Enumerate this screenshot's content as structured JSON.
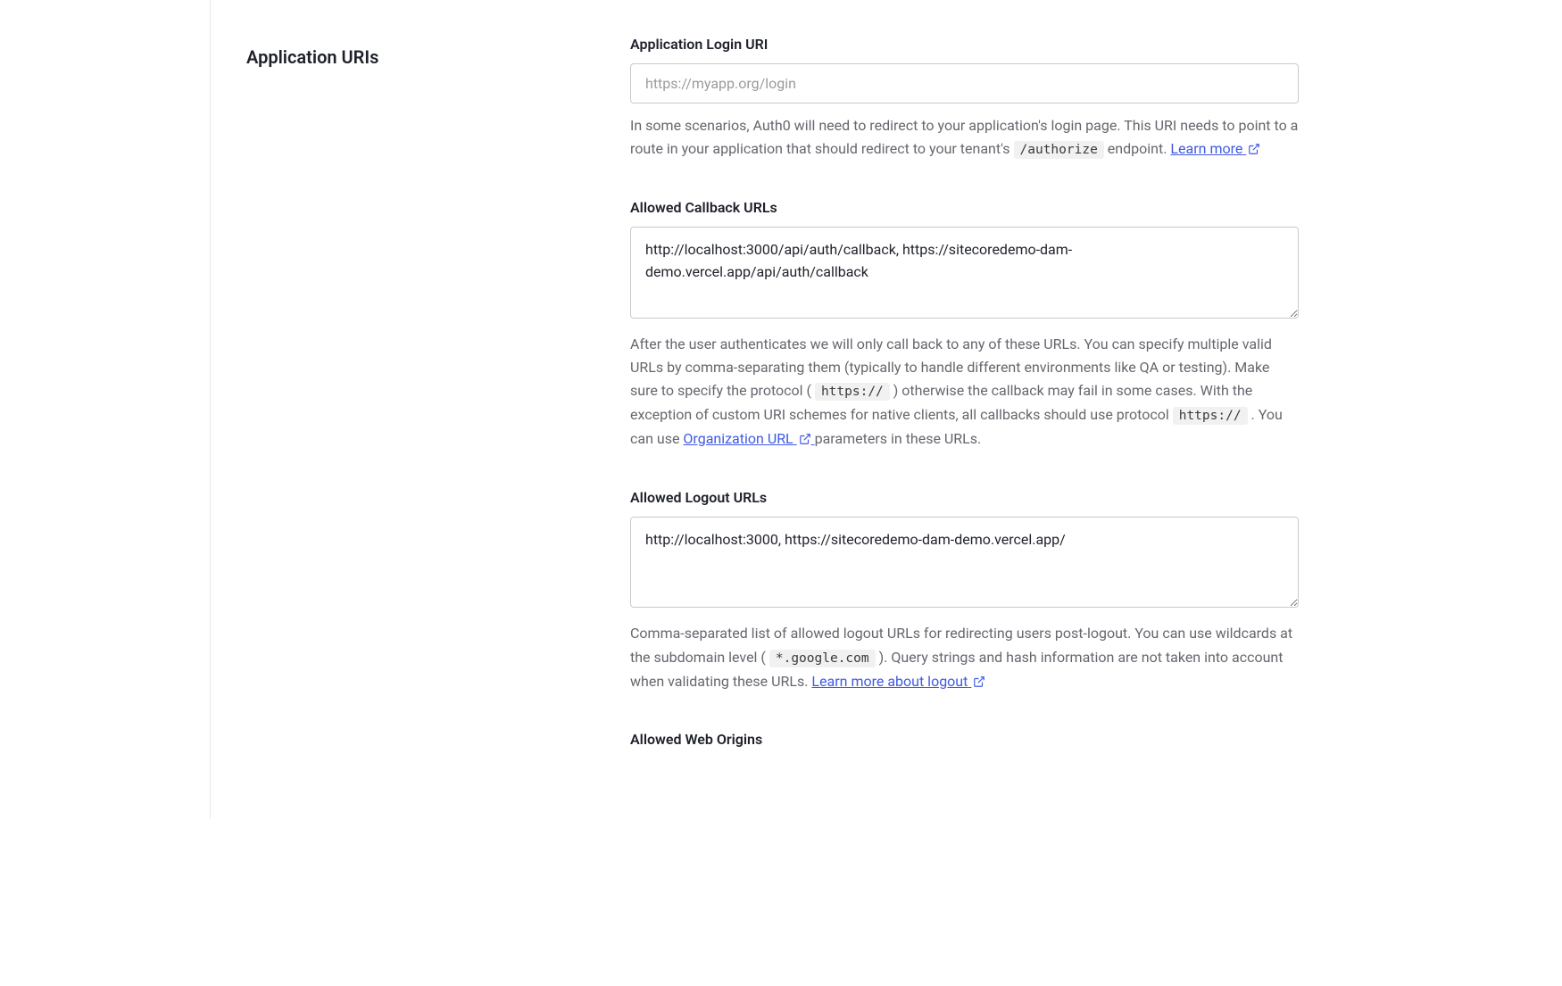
{
  "section": {
    "title": "Application URIs"
  },
  "fields": {
    "login_uri": {
      "label": "Application Login URI",
      "placeholder": "https://myapp.org/login",
      "value": "",
      "help_pre": "In some scenarios, Auth0 will need to redirect to your application's login page. This URI needs to point to a route in your application that should redirect to your tenant's ",
      "help_code": "/authorize",
      "help_post": " endpoint. ",
      "link_text": "Learn more"
    },
    "callback_urls": {
      "label": "Allowed Callback URLs",
      "value": "http://localhost:3000/api/auth/callback, https://sitecoredemo-dam-demo.vercel.app/api/auth/callback",
      "help_p1": "After the user authenticates we will only call back to any of these URLs. You can specify multiple valid URLs by comma-separating them (typically to handle different environments like QA or testing). Make sure to specify the protocol (",
      "help_code1": "https://",
      "help_p2": ") otherwise the callback may fail in some cases. With the exception of custom URI schemes for native clients, all callbacks should use protocol ",
      "help_code2": "https://",
      "help_p3": ". You can use ",
      "link_text": "Organization URL",
      "help_p4": " parameters in these URLs."
    },
    "logout_urls": {
      "label": "Allowed Logout URLs",
      "value": "http://localhost:3000, https://sitecoredemo-dam-demo.vercel.app/",
      "help_p1": "Comma-separated list of allowed logout URLs for redirecting users post-logout. You can use wildcards at the subdomain level (",
      "help_code": "*.google.com",
      "help_p2": "). Query strings and hash information are not taken into account when validating these URLs. ",
      "link_text": "Learn more about logout"
    },
    "web_origins": {
      "label": "Allowed Web Origins"
    }
  }
}
